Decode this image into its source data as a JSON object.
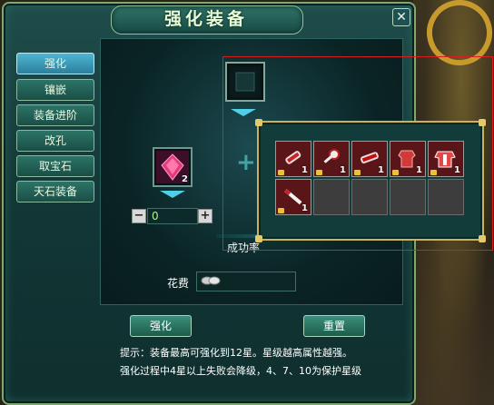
{
  "window": {
    "title": "强化装备",
    "close_glyph": "✕"
  },
  "tabs": [
    {
      "label": "强化",
      "active": true
    },
    {
      "label": "镶嵌",
      "active": false
    },
    {
      "label": "装备进阶",
      "active": false
    },
    {
      "label": "改孔",
      "active": false
    },
    {
      "label": "取宝石",
      "active": false
    },
    {
      "label": "天石装备",
      "active": false
    }
  ],
  "forge": {
    "stone_slot_icon": "gem-icon",
    "stone_count": "2",
    "quantity": "0",
    "minus": "−",
    "plus": "+",
    "success_label": "成功率",
    "cost_label": "花费",
    "cost_icon": "coin-icon"
  },
  "inventory": {
    "items": [
      {
        "icon": "red-scroll-icon",
        "count": "1",
        "locked": true
      },
      {
        "icon": "red-key-icon",
        "count": "1",
        "locked": true
      },
      {
        "icon": "red-scroll-icon",
        "count": "1",
        "locked": true
      },
      {
        "icon": "red-armor-icon",
        "count": "1",
        "locked": true
      },
      {
        "icon": "red-armor-icon",
        "count": "1",
        "locked": true
      },
      {
        "icon": "red-sword-icon",
        "count": "1",
        "locked": true
      }
    ],
    "empty_slots": 4
  },
  "buttons": {
    "enhance": "强化",
    "reset": "重置"
  },
  "tips": {
    "line1": "提示：装备最高可强化到12星。星级越高属性越强。",
    "line2": "强化过程中4星以上失败会降级，4、7、10为保护星级"
  },
  "colors": {
    "accent": "#4fd0e6",
    "gold": "#c9b25c",
    "red_frame": "#d42020"
  }
}
